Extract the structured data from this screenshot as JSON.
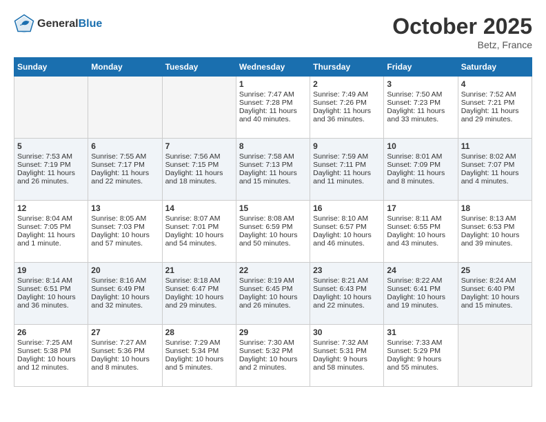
{
  "header": {
    "logo_line1": "General",
    "logo_line2": "Blue",
    "month_title": "October 2025",
    "location": "Betz, France"
  },
  "days_of_week": [
    "Sunday",
    "Monday",
    "Tuesday",
    "Wednesday",
    "Thursday",
    "Friday",
    "Saturday"
  ],
  "weeks": [
    [
      {
        "day": "",
        "lines": []
      },
      {
        "day": "",
        "lines": []
      },
      {
        "day": "",
        "lines": []
      },
      {
        "day": "1",
        "lines": [
          "Sunrise: 7:47 AM",
          "Sunset: 7:28 PM",
          "Daylight: 11 hours",
          "and 40 minutes."
        ]
      },
      {
        "day": "2",
        "lines": [
          "Sunrise: 7:49 AM",
          "Sunset: 7:26 PM",
          "Daylight: 11 hours",
          "and 36 minutes."
        ]
      },
      {
        "day": "3",
        "lines": [
          "Sunrise: 7:50 AM",
          "Sunset: 7:23 PM",
          "Daylight: 11 hours",
          "and 33 minutes."
        ]
      },
      {
        "day": "4",
        "lines": [
          "Sunrise: 7:52 AM",
          "Sunset: 7:21 PM",
          "Daylight: 11 hours",
          "and 29 minutes."
        ]
      }
    ],
    [
      {
        "day": "5",
        "lines": [
          "Sunrise: 7:53 AM",
          "Sunset: 7:19 PM",
          "Daylight: 11 hours",
          "and 26 minutes."
        ]
      },
      {
        "day": "6",
        "lines": [
          "Sunrise: 7:55 AM",
          "Sunset: 7:17 PM",
          "Daylight: 11 hours",
          "and 22 minutes."
        ]
      },
      {
        "day": "7",
        "lines": [
          "Sunrise: 7:56 AM",
          "Sunset: 7:15 PM",
          "Daylight: 11 hours",
          "and 18 minutes."
        ]
      },
      {
        "day": "8",
        "lines": [
          "Sunrise: 7:58 AM",
          "Sunset: 7:13 PM",
          "Daylight: 11 hours",
          "and 15 minutes."
        ]
      },
      {
        "day": "9",
        "lines": [
          "Sunrise: 7:59 AM",
          "Sunset: 7:11 PM",
          "Daylight: 11 hours",
          "and 11 minutes."
        ]
      },
      {
        "day": "10",
        "lines": [
          "Sunrise: 8:01 AM",
          "Sunset: 7:09 PM",
          "Daylight: 11 hours",
          "and 8 minutes."
        ]
      },
      {
        "day": "11",
        "lines": [
          "Sunrise: 8:02 AM",
          "Sunset: 7:07 PM",
          "Daylight: 11 hours",
          "and 4 minutes."
        ]
      }
    ],
    [
      {
        "day": "12",
        "lines": [
          "Sunrise: 8:04 AM",
          "Sunset: 7:05 PM",
          "Daylight: 11 hours",
          "and 1 minute."
        ]
      },
      {
        "day": "13",
        "lines": [
          "Sunrise: 8:05 AM",
          "Sunset: 7:03 PM",
          "Daylight: 10 hours",
          "and 57 minutes."
        ]
      },
      {
        "day": "14",
        "lines": [
          "Sunrise: 8:07 AM",
          "Sunset: 7:01 PM",
          "Daylight: 10 hours",
          "and 54 minutes."
        ]
      },
      {
        "day": "15",
        "lines": [
          "Sunrise: 8:08 AM",
          "Sunset: 6:59 PM",
          "Daylight: 10 hours",
          "and 50 minutes."
        ]
      },
      {
        "day": "16",
        "lines": [
          "Sunrise: 8:10 AM",
          "Sunset: 6:57 PM",
          "Daylight: 10 hours",
          "and 46 minutes."
        ]
      },
      {
        "day": "17",
        "lines": [
          "Sunrise: 8:11 AM",
          "Sunset: 6:55 PM",
          "Daylight: 10 hours",
          "and 43 minutes."
        ]
      },
      {
        "day": "18",
        "lines": [
          "Sunrise: 8:13 AM",
          "Sunset: 6:53 PM",
          "Daylight: 10 hours",
          "and 39 minutes."
        ]
      }
    ],
    [
      {
        "day": "19",
        "lines": [
          "Sunrise: 8:14 AM",
          "Sunset: 6:51 PM",
          "Daylight: 10 hours",
          "and 36 minutes."
        ]
      },
      {
        "day": "20",
        "lines": [
          "Sunrise: 8:16 AM",
          "Sunset: 6:49 PM",
          "Daylight: 10 hours",
          "and 32 minutes."
        ]
      },
      {
        "day": "21",
        "lines": [
          "Sunrise: 8:18 AM",
          "Sunset: 6:47 PM",
          "Daylight: 10 hours",
          "and 29 minutes."
        ]
      },
      {
        "day": "22",
        "lines": [
          "Sunrise: 8:19 AM",
          "Sunset: 6:45 PM",
          "Daylight: 10 hours",
          "and 26 minutes."
        ]
      },
      {
        "day": "23",
        "lines": [
          "Sunrise: 8:21 AM",
          "Sunset: 6:43 PM",
          "Daylight: 10 hours",
          "and 22 minutes."
        ]
      },
      {
        "day": "24",
        "lines": [
          "Sunrise: 8:22 AM",
          "Sunset: 6:41 PM",
          "Daylight: 10 hours",
          "and 19 minutes."
        ]
      },
      {
        "day": "25",
        "lines": [
          "Sunrise: 8:24 AM",
          "Sunset: 6:40 PM",
          "Daylight: 10 hours",
          "and 15 minutes."
        ]
      }
    ],
    [
      {
        "day": "26",
        "lines": [
          "Sunrise: 7:25 AM",
          "Sunset: 5:38 PM",
          "Daylight: 10 hours",
          "and 12 minutes."
        ]
      },
      {
        "day": "27",
        "lines": [
          "Sunrise: 7:27 AM",
          "Sunset: 5:36 PM",
          "Daylight: 10 hours",
          "and 8 minutes."
        ]
      },
      {
        "day": "28",
        "lines": [
          "Sunrise: 7:29 AM",
          "Sunset: 5:34 PM",
          "Daylight: 10 hours",
          "and 5 minutes."
        ]
      },
      {
        "day": "29",
        "lines": [
          "Sunrise: 7:30 AM",
          "Sunset: 5:32 PM",
          "Daylight: 10 hours",
          "and 2 minutes."
        ]
      },
      {
        "day": "30",
        "lines": [
          "Sunrise: 7:32 AM",
          "Sunset: 5:31 PM",
          "Daylight: 9 hours",
          "and 58 minutes."
        ]
      },
      {
        "day": "31",
        "lines": [
          "Sunrise: 7:33 AM",
          "Sunset: 5:29 PM",
          "Daylight: 9 hours",
          "and 55 minutes."
        ]
      },
      {
        "day": "",
        "lines": []
      }
    ]
  ]
}
